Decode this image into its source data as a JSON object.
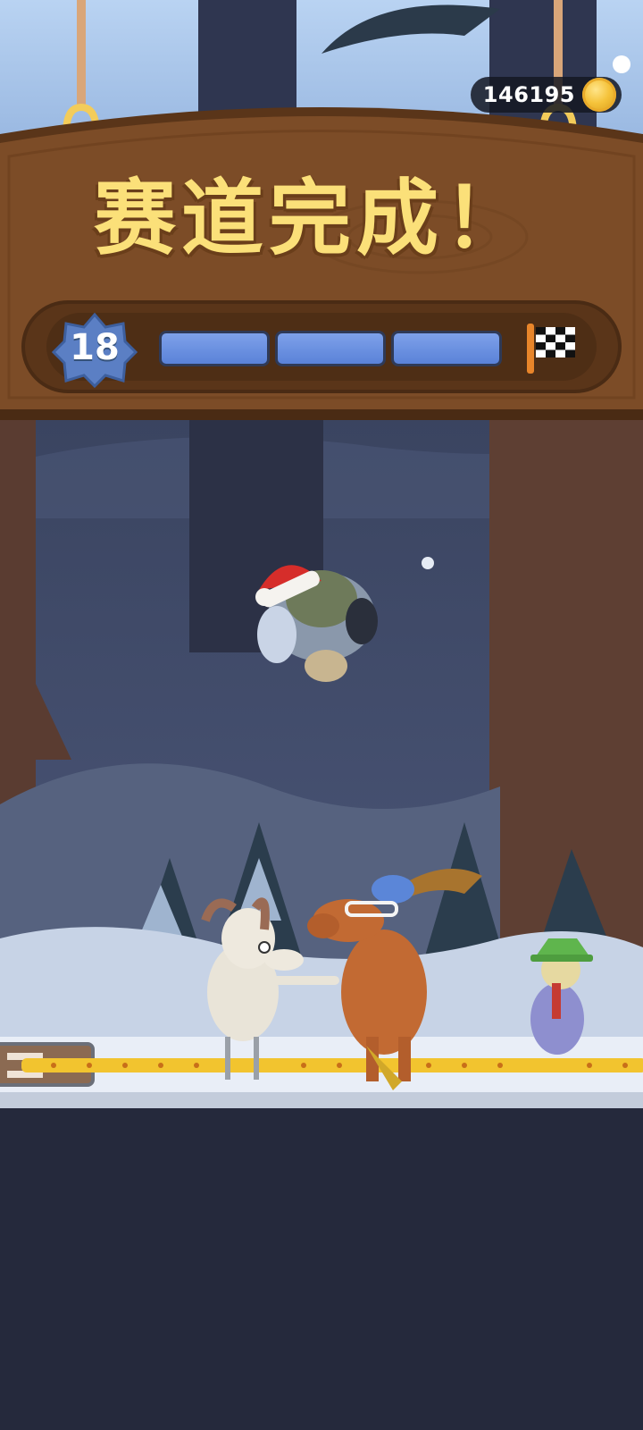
{
  "header": {
    "coins": "146195",
    "coin_icon": "gold-coin-icon",
    "notification_dot": true
  },
  "banner": {
    "title": "赛道完成！"
  },
  "progress": {
    "level": "18",
    "segments_total": 3,
    "segments_filled": 3,
    "finish_icon": "checkered-flag-icon"
  },
  "scene": {
    "characters": [
      "goat-character",
      "moose-character",
      "scarecrow-character",
      "flipping-rider-character"
    ]
  },
  "colors": {
    "sky": "#a9c6ea",
    "wood": "#7a4b26",
    "title": "#fbe079",
    "progress_blue": "#6b8fe0",
    "night_forest": "#3b4560",
    "ground_snow": "#e9eef7",
    "bottom_bg": "#25293c"
  }
}
